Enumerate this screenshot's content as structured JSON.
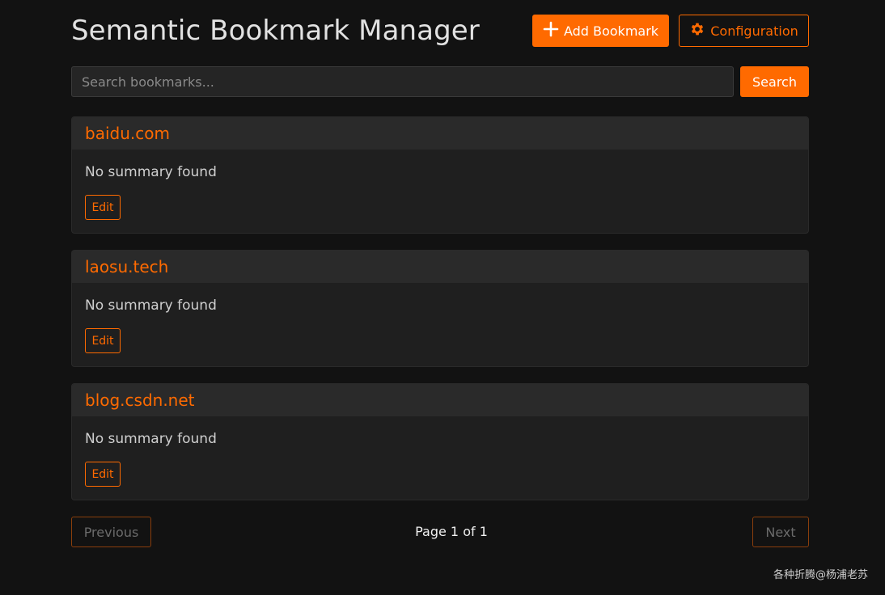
{
  "header": {
    "title": "Semantic Bookmark Manager",
    "add_label": "Add Bookmark",
    "config_label": "Configuration"
  },
  "search": {
    "placeholder": "Search bookmarks...",
    "button_label": "Search"
  },
  "bookmarks": [
    {
      "title": "baidu.com",
      "summary": "No summary found",
      "edit_label": "Edit"
    },
    {
      "title": "laosu.tech",
      "summary": "No summary found",
      "edit_label": "Edit"
    },
    {
      "title": "blog.csdn.net",
      "summary": "No summary found",
      "edit_label": "Edit"
    }
  ],
  "pagination": {
    "previous_label": "Previous",
    "page_info": "Page 1 of 1",
    "next_label": "Next"
  },
  "watermark": "各种折腾@杨浦老苏",
  "colors": {
    "accent": "#ff6a00",
    "background": "#121212",
    "card": "#1f1f1f"
  },
  "icons": {
    "add": "plus-icon",
    "config": "gear-icon"
  }
}
